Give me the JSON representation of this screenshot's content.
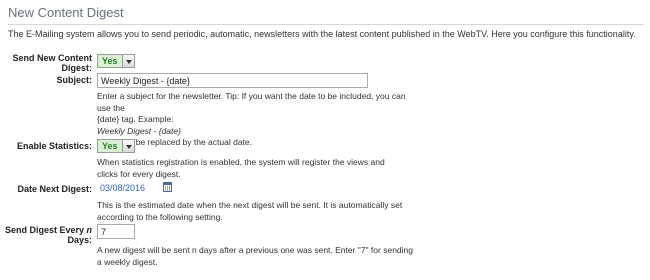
{
  "page": {
    "title": "New Content Digest",
    "intro": "The E-Mailing system allows you to send periodic, automatic, newsletters with the latest content published in the WebTV. Here you configure this functionality."
  },
  "send_digest": {
    "label": "Send New Content Digest:",
    "value": "Yes"
  },
  "subject": {
    "label": "Subject:",
    "value": "Weekly Digest - {date}",
    "help_line1": "Enter a subject for the newsletter. Tip: If you want the date to be included, you can use the",
    "help_line2": "{date} tag. Example:",
    "help_example": "Weekly Digest - {date}",
    "help_line3": "{date} will be replaced by the actual date."
  },
  "statistics": {
    "label": "Enable Statistics:",
    "value": "Yes",
    "help": "When statistics registration is enabled, the system will register the views and clicks for every digest."
  },
  "next_digest": {
    "label": "Date Next Digest:",
    "value": "03/08/2016",
    "help": "This is the estimated date when the next digest will be sent. It is automatically set according to the following setting."
  },
  "every_n_days": {
    "label_part1": "Send Digest Every ",
    "label_n": "n",
    "label_part2": " Days:",
    "value": "7",
    "help": "A new digest will be sent n days after a previous one was sent. Enter \"7\" for sending a weekly digest."
  }
}
